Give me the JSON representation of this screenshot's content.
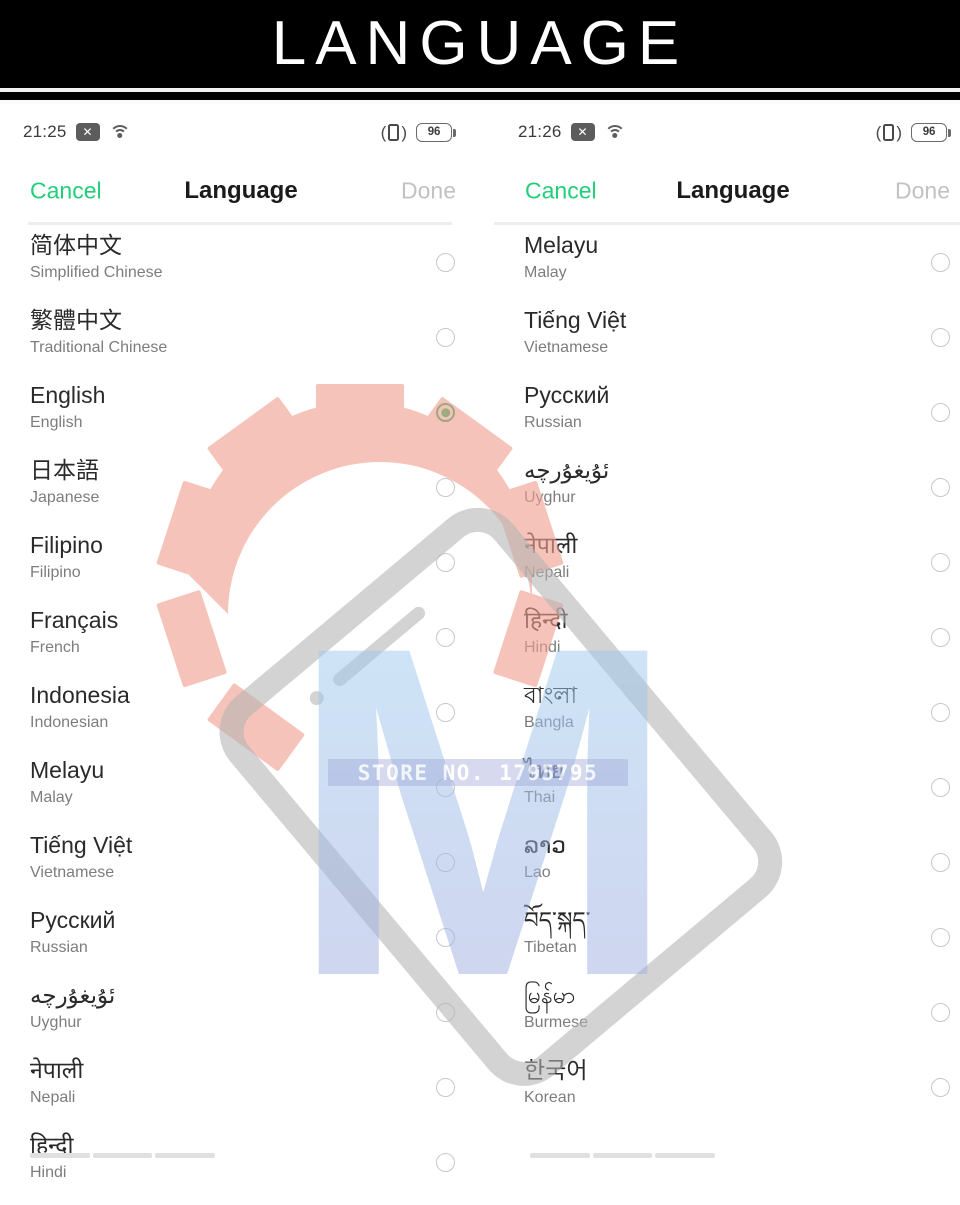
{
  "banner": {
    "title": "LANGUAGE"
  },
  "watermark": {
    "letter": "M",
    "store_text": "STORE NO. 1795795"
  },
  "screens": [
    {
      "id": "left",
      "status": {
        "time": "21:25",
        "dnd_icon": "x-badge-icon",
        "wifi_icon": "wifi-icon",
        "vibrate_icon": "vibrate-icon",
        "battery_level": "96"
      },
      "nav": {
        "cancel": "Cancel",
        "title": "Language",
        "done": "Done"
      },
      "rows": [
        {
          "native": "简体中文",
          "english": "Simplified Chinese",
          "selected": false
        },
        {
          "native": "繁體中文",
          "english": "Traditional Chinese",
          "selected": false
        },
        {
          "native": "English",
          "english": "English",
          "selected": true
        },
        {
          "native": "日本語",
          "english": "Japanese",
          "selected": false
        },
        {
          "native": "Filipino",
          "english": "Filipino",
          "selected": false
        },
        {
          "native": "Français",
          "english": "French",
          "selected": false
        },
        {
          "native": "Indonesia",
          "english": "Indonesian",
          "selected": false
        },
        {
          "native": "Melayu",
          "english": "Malay",
          "selected": false
        },
        {
          "native": "Tiếng Việt",
          "english": "Vietnamese",
          "selected": false
        },
        {
          "native": "Русский",
          "english": "Russian",
          "selected": false
        },
        {
          "native": "ئۇيغۇرچە",
          "english": "Uyghur",
          "selected": false
        },
        {
          "native": "नेपाली",
          "english": "Nepali",
          "selected": false
        },
        {
          "native": "हिन्दी",
          "english": "Hindi",
          "selected": false
        }
      ]
    },
    {
      "id": "right",
      "status": {
        "time": "21:26",
        "dnd_icon": "x-badge-icon",
        "wifi_icon": "wifi-icon",
        "vibrate_icon": "vibrate-icon",
        "battery_level": "96"
      },
      "nav": {
        "cancel": "Cancel",
        "title": "Language",
        "done": "Done"
      },
      "rows": [
        {
          "native": "Melayu",
          "english": "Malay",
          "selected": false
        },
        {
          "native": "Tiếng Việt",
          "english": "Vietnamese",
          "selected": false
        },
        {
          "native": "Русский",
          "english": "Russian",
          "selected": false
        },
        {
          "native": "ئۇيغۇرچە",
          "english": "Uyghur",
          "selected": false
        },
        {
          "native": "नेपाली",
          "english": "Nepali",
          "selected": false
        },
        {
          "native": "हिन्दी",
          "english": "Hindi",
          "selected": false
        },
        {
          "native": "বাংলা",
          "english": "Bangla",
          "selected": false
        },
        {
          "native": "ไทย",
          "english": "Thai",
          "selected": false
        },
        {
          "native": "ລາວ",
          "english": "Lao",
          "selected": false
        },
        {
          "native": "བོད་སྐད་",
          "english": "Tibetan",
          "selected": false
        },
        {
          "native": "မြန်မာ",
          "english": "Burmese",
          "selected": false
        },
        {
          "native": "한국어",
          "english": "Korean",
          "selected": false
        }
      ]
    }
  ],
  "colors": {
    "accent_green": "#21ce7a",
    "selected_green": "#16c263",
    "banner_bg": "#000000",
    "title_text": "#1b1b1b",
    "subtitle_text": "#7d7d7d",
    "disabled_text": "#c2c2c2"
  }
}
